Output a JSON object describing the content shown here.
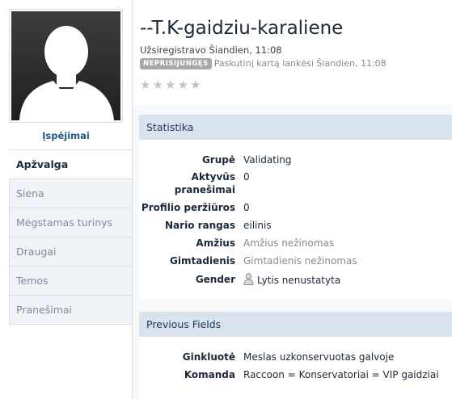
{
  "profile": {
    "username": "--T.K-gaidziu-karaliene",
    "registered": "Užsiregistravo Šiandien, 11:08",
    "status_badge": "NEPRISIJUNGĘS",
    "last_visit": "Paskutinį kartą lankėsi Šiandien, 11:08",
    "rating_stars": [
      "★",
      "★",
      "★",
      "★",
      "★"
    ],
    "rating_value": 0
  },
  "sidebar": {
    "warnings": "Įspėjimai",
    "tabs": [
      {
        "label": "Apžvalga",
        "active": true
      },
      {
        "label": "Siena",
        "active": false
      },
      {
        "label": "Mėgstamas turinys",
        "active": false
      },
      {
        "label": "Draugai",
        "active": false
      },
      {
        "label": "Temos",
        "active": false
      },
      {
        "label": "Pranešimai",
        "active": false
      }
    ]
  },
  "statistics": {
    "title": "Statistika",
    "rows": [
      {
        "label": "Grupė",
        "value": "Validating"
      },
      {
        "label": "Aktyvūs pranešimai",
        "label_line1": "Aktyvūs",
        "label_line2": "pranešimai",
        "value": "0"
      },
      {
        "label": "Profilio peržiūros",
        "value": "0"
      },
      {
        "label": "Nario rangas",
        "value": "eilinis"
      },
      {
        "label": "Amžius",
        "value": "Amžius nežinomas"
      },
      {
        "label": "Gimtadienis",
        "value": "Gimtadienis nežinomas"
      },
      {
        "label": "Gender",
        "value": "Lytis nenustatyta",
        "icon": "person-icon"
      }
    ]
  },
  "previous_fields": {
    "title": "Previous Fields",
    "rows": [
      {
        "label": "Ginkluotė",
        "value": "Meslas uzkonservuotas galvoje"
      },
      {
        "label": "Komanda",
        "value": "Raccoon = Konservatoriai = VIP gaidziai"
      }
    ]
  },
  "colors": {
    "section_header_bg": "#d9e3ee",
    "link": "#225985",
    "badge_bg": "#a8a8a8"
  }
}
